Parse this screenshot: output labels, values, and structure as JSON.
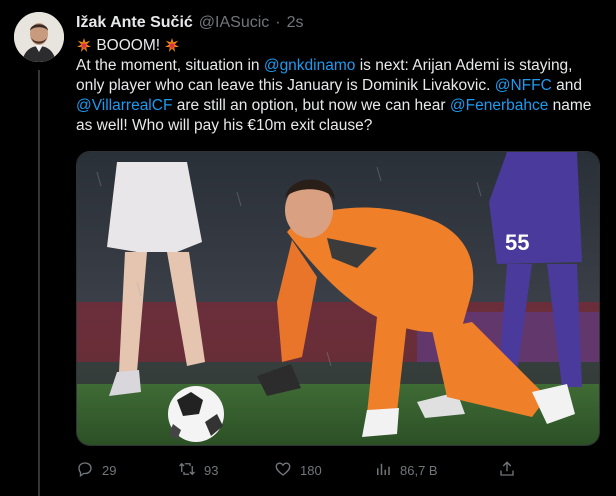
{
  "author": {
    "name": "Ižak Ante Sučić",
    "handle": "@IASucic",
    "separator": "·",
    "time": "2s"
  },
  "tweet": {
    "headline": "BOOOM!",
    "headline_icon": "collision-emoji",
    "line1_a": "At the moment, situation in ",
    "mention_dinamo": "@gnkdinamo",
    "line1_b": " is next: Arijan Ademi is staying,",
    "line2": "only player who can leave this January is Dominik Livakovic. ",
    "mention_nffc": "@NFFC",
    "line2_b": " and",
    "mention_villarreal": "@VillarrealCF",
    "line3_a": " are still an option, but now we can hear ",
    "mention_fener": "@Fenerbahce",
    "line3_b": " name",
    "line4": "as well! Who will pay his €10m exit clause?"
  },
  "media": {
    "description_icon": "goalkeeper-photo",
    "kit_number": "55"
  },
  "actions": {
    "replies": "29",
    "retweets": "93",
    "likes": "180",
    "views": "86,7 B",
    "reply_icon": "reply-icon",
    "retweet_icon": "retweet-icon",
    "like_icon": "heart-icon",
    "views_icon": "views-icon",
    "share_icon": "share-icon"
  },
  "colors": {
    "background": "#000000",
    "text": "#e7e9ea",
    "muted": "#71767b",
    "link": "#1d9bf0",
    "kit_orange": "#f07f2a"
  }
}
